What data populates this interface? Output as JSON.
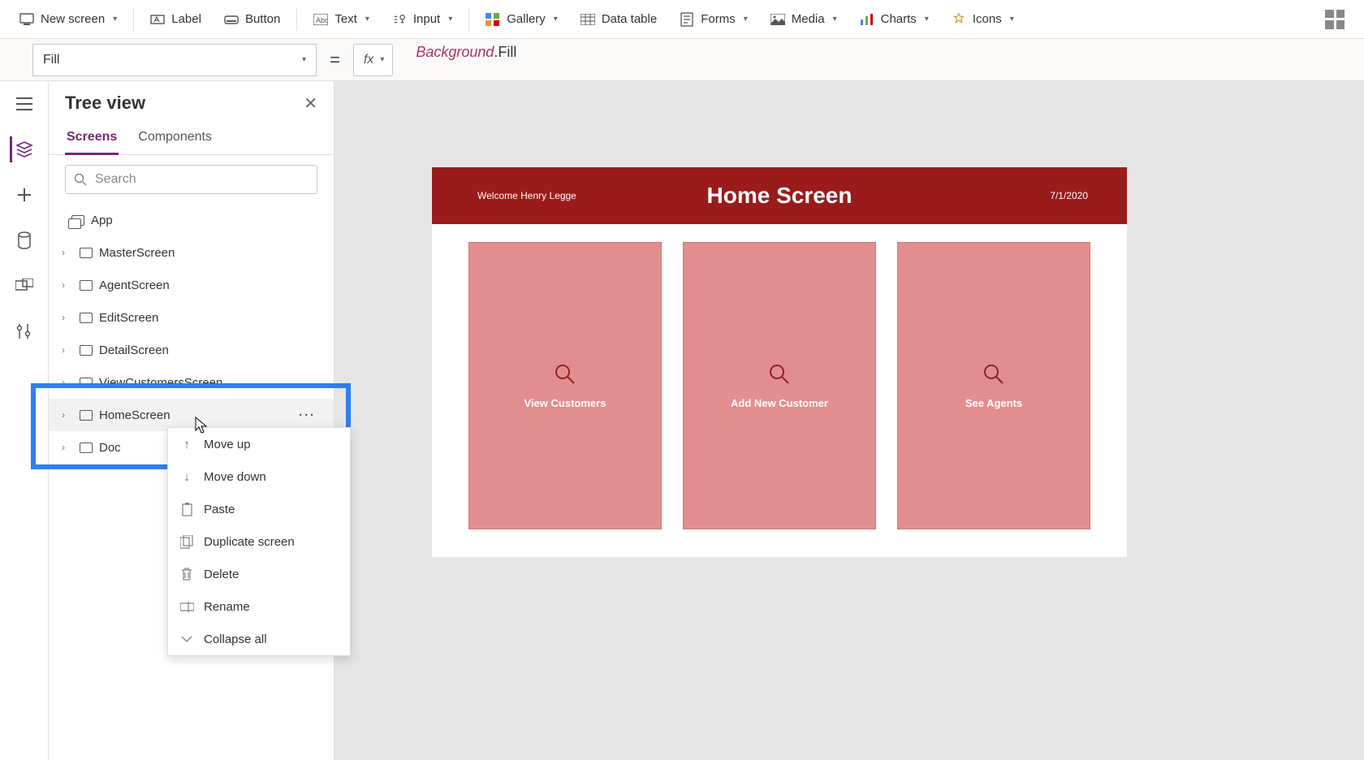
{
  "toolbar": {
    "new_screen": "New screen",
    "label": "Label",
    "button": "Button",
    "text": "Text",
    "input": "Input",
    "gallery": "Gallery",
    "data_table": "Data table",
    "forms": "Forms",
    "media": "Media",
    "charts": "Charts",
    "icons": "Icons"
  },
  "formula": {
    "property": "Fill",
    "fx": "fx",
    "referenceToken": "Background",
    "memberToken": ".Fill"
  },
  "tree": {
    "title": "Tree view",
    "tabs": {
      "screens": "Screens",
      "components": "Components"
    },
    "search_placeholder": "Search",
    "app_root": "App",
    "items": [
      "MasterScreen",
      "AgentScreen",
      "EditScreen",
      "DetailScreen",
      "ViewCustomersScreen",
      "HomeScreen",
      "Doc"
    ]
  },
  "context_menu": {
    "move_up": "Move up",
    "move_down": "Move down",
    "paste": "Paste",
    "duplicate": "Duplicate screen",
    "delete": "Delete",
    "rename": "Rename",
    "collapse_all": "Collapse all"
  },
  "canvas": {
    "welcome": "Welcome Henry Legge",
    "title": "Home Screen",
    "date": "7/1/2020",
    "tiles": {
      "view_customers": "View Customers",
      "add_customer": "Add New Customer",
      "see_agents": "See Agents"
    }
  }
}
